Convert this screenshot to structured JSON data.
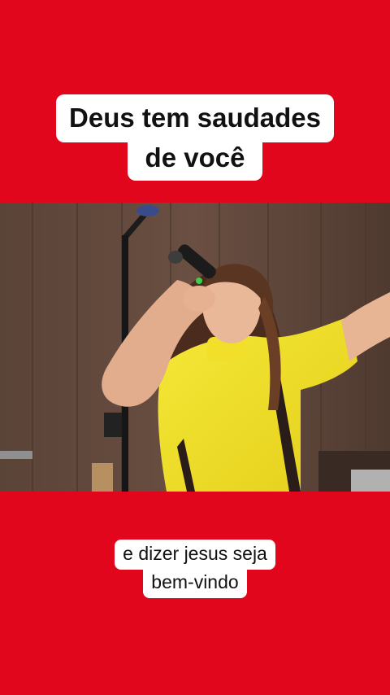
{
  "overlay": {
    "title_line1": "Deus tem saudades",
    "title_line2": "de você",
    "subtitle_line1": "e dizer jesus seja",
    "subtitle_line2": "bem-vindo"
  },
  "colors": {
    "background": "#e1061c",
    "caption_bg": "#ffffff",
    "caption_text": "#111111",
    "shirt": "#f2e226",
    "wall": "#5b4438"
  },
  "icons": [
    "microphone-icon",
    "mic-stand-icon"
  ]
}
